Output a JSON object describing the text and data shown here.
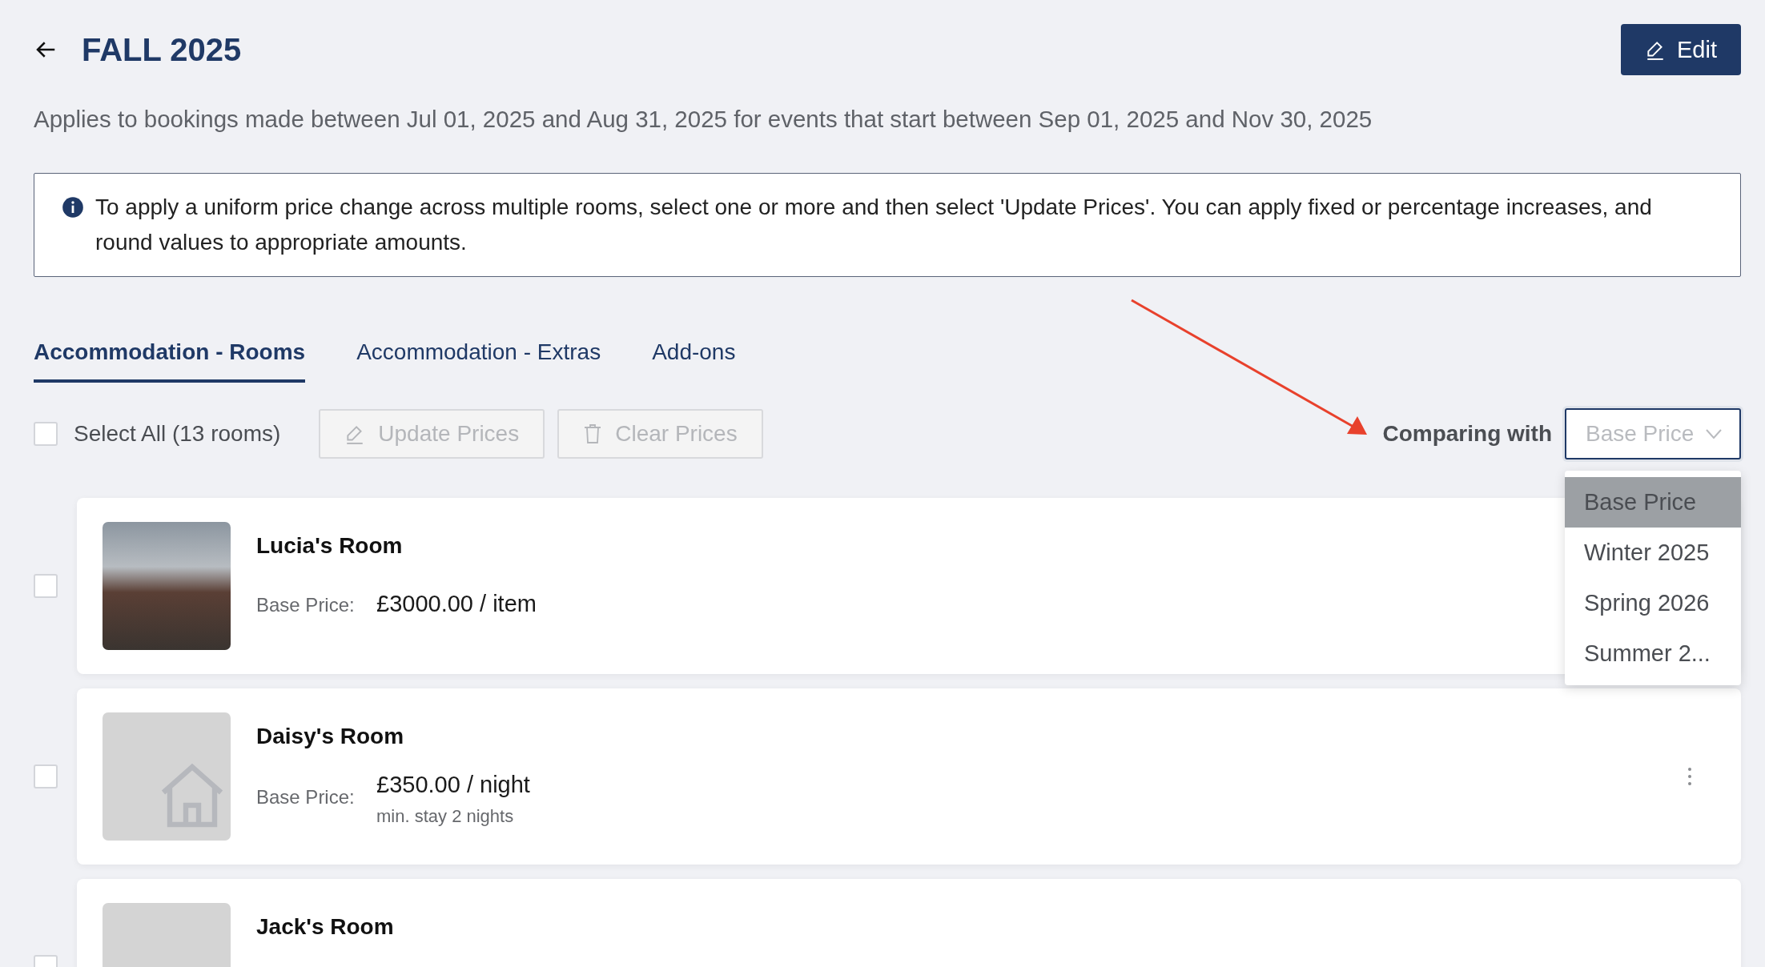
{
  "header": {
    "title": "FALL 2025",
    "edit_button": "Edit"
  },
  "subtitle": "Applies to bookings made between Jul 01, 2025 and Aug 31, 2025 for events that start between Sep 01, 2025 and Nov 30, 2025",
  "info": "To apply a uniform price change across multiple rooms, select one or more and then select 'Update Prices'. You can apply fixed or percentage increases, and round values to appropriate amounts.",
  "tabs": [
    {
      "label": "Accommodation - Rooms",
      "selected": true
    },
    {
      "label": "Accommodation - Extras",
      "selected": false
    },
    {
      "label": "Add-ons",
      "selected": false
    }
  ],
  "toolbar": {
    "select_all": {
      "label": "Select All (13 rooms)",
      "checked": false
    },
    "buttons": [
      {
        "label": "Update Prices",
        "kind": "edit",
        "disabled": true
      },
      {
        "label": "Clear Prices",
        "kind": "clear",
        "disabled": true
      }
    ],
    "comparing_label": "Comparing with",
    "dropdown": {
      "placeholder": "Base Price",
      "expanded": true,
      "options": [
        {
          "label": "Base Price",
          "selected": true
        },
        {
          "label": "Winter 2025",
          "selected": false
        },
        {
          "label": "Spring 2026",
          "selected": false
        },
        {
          "label": "Summer 2...",
          "selected": false
        }
      ]
    }
  },
  "rooms": [
    {
      "name": "Lucia's Room",
      "kind": "photo",
      "checked": false,
      "price_label": "Base Price:",
      "price": "£3000.00 / item",
      "has_menu": false
    },
    {
      "name": "Daisy's Room",
      "kind": "placeholder",
      "checked": false,
      "price_label": "Base Price:",
      "price": "£350.00 / night",
      "note": "min. stay 2 nights",
      "has_menu": true
    },
    {
      "name": "Jack's Room",
      "kind": "blank",
      "checked": false,
      "has_menu": false
    }
  ]
}
